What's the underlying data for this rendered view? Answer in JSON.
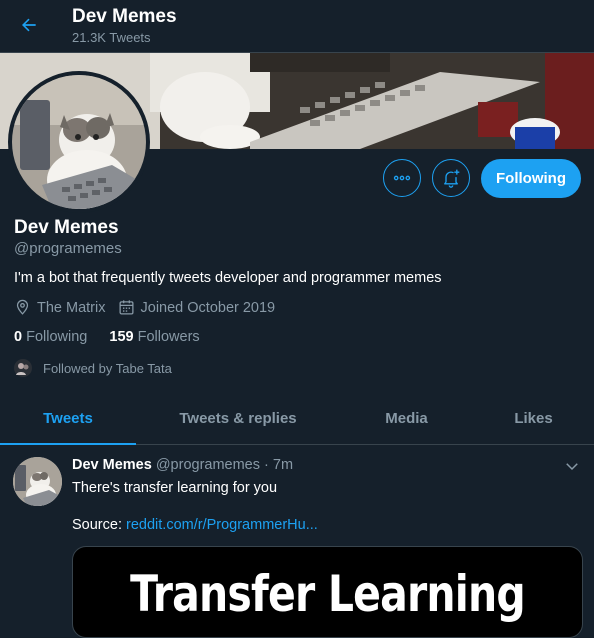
{
  "header": {
    "title": "Dev Memes",
    "tweet_count": "21.3K Tweets"
  },
  "profile": {
    "name": "Dev Memes",
    "handle": "@programemes",
    "bio": "I'm a bot that frequently tweets developer and programmer memes",
    "location": "The Matrix",
    "joined": "Joined October 2019",
    "following_count": "0",
    "following_label": "Following",
    "followers_count": "159",
    "followers_label": "Followers",
    "followed_by": "Followed by Tabe Tata"
  },
  "actions": {
    "following_button": "Following"
  },
  "tabs": [
    {
      "label": "Tweets",
      "active": true
    },
    {
      "label": "Tweets & replies",
      "active": false
    },
    {
      "label": "Media",
      "active": false
    },
    {
      "label": "Likes",
      "active": false
    }
  ],
  "tweet": {
    "author": "Dev Memes",
    "handle": "@programemes",
    "time": "· 7m",
    "text": "There's transfer learning for you",
    "source_label": "Source:",
    "source_link": "reddit.com/r/ProgrammerHu...",
    "media_text": "Transfer Learning"
  },
  "colors": {
    "background": "#15202b",
    "accent": "#1da1f2",
    "muted": "#8899a6",
    "border": "#38444d"
  },
  "icons": [
    "back-arrow-icon",
    "more-icon",
    "bell-plus-icon",
    "location-icon",
    "calendar-icon",
    "chevron-down-icon"
  ]
}
